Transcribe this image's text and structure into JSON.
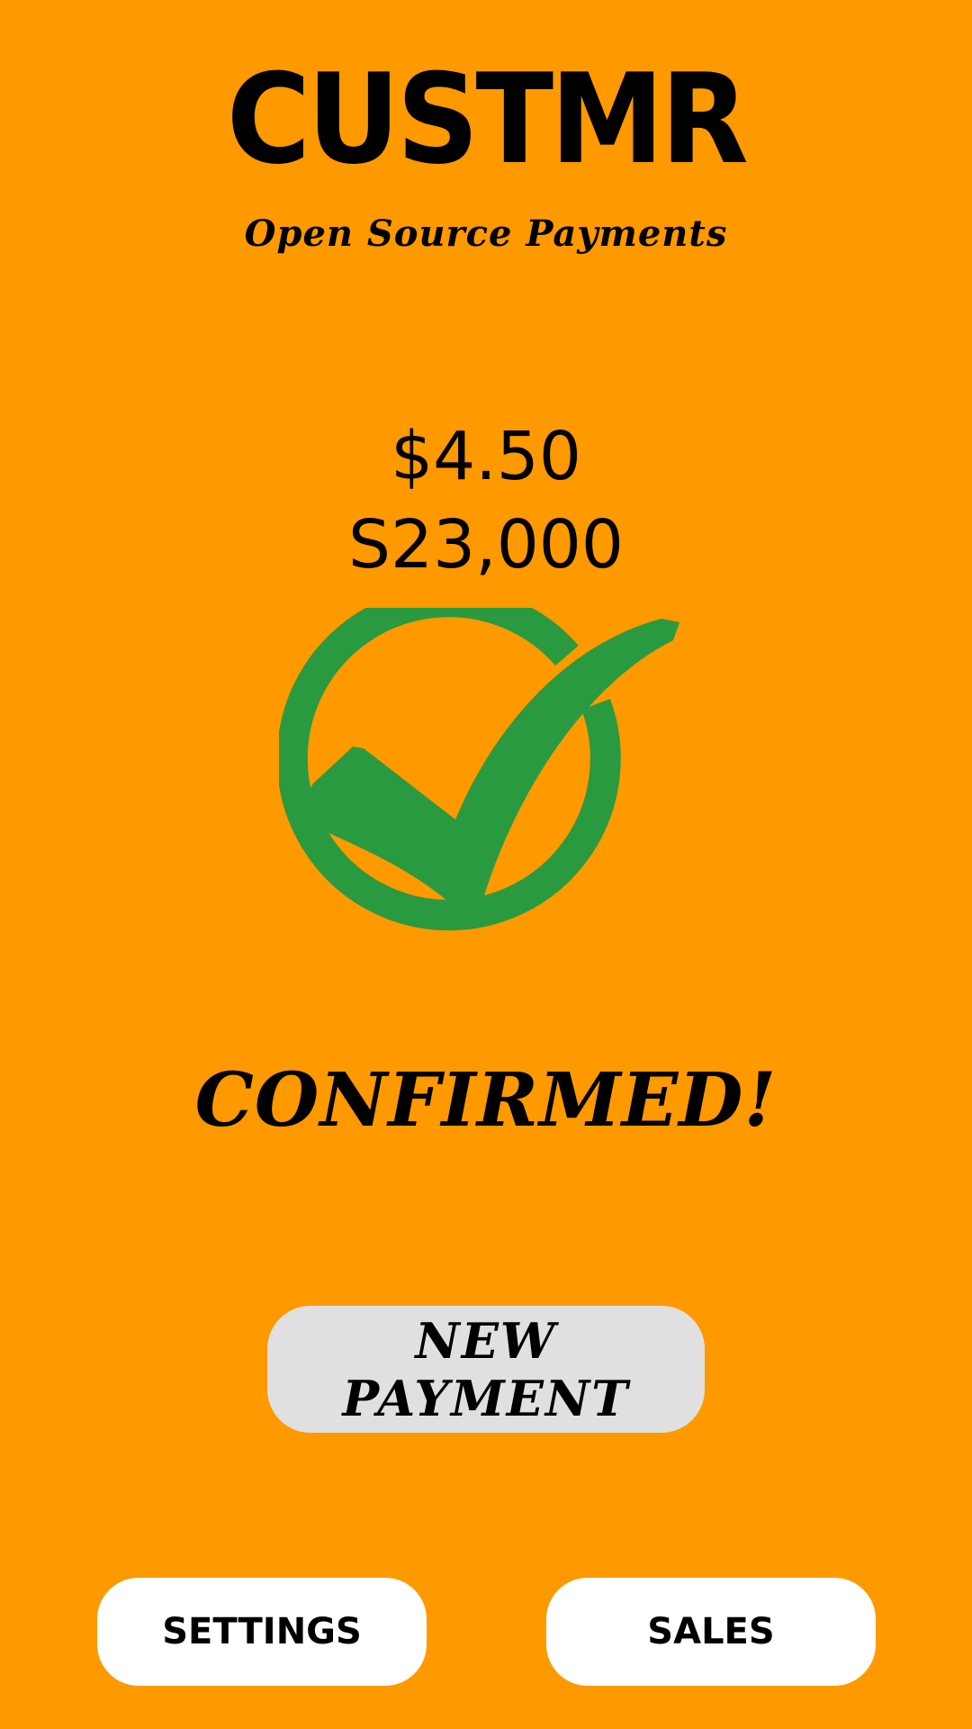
{
  "header": {
    "app_title": "CUSTMR",
    "tagline": "Open Source Payments"
  },
  "payment": {
    "amount_primary": "$4.50",
    "amount_secondary": "S23,000",
    "status": "CONFIRMED!",
    "status_icon": "check-circle-icon"
  },
  "actions": {
    "new_payment_label": "NEW PAYMENT"
  },
  "footer": {
    "settings_label": "SETTINGS",
    "sales_label": "SALES"
  },
  "colors": {
    "background": "#FF9900",
    "confirm_green": "#2A9A40",
    "primary_button_bg": "#E0E0E0",
    "secondary_button_bg": "#FFFFFF",
    "text": "#000000"
  }
}
